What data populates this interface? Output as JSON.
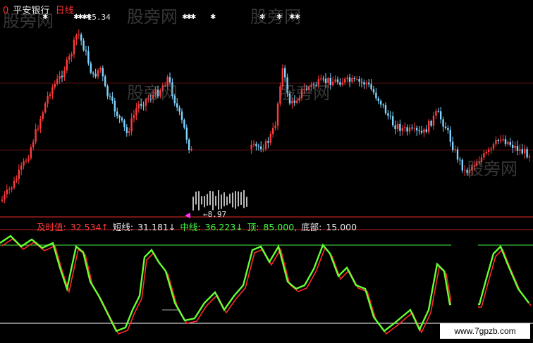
{
  "header": {
    "marker": "0",
    "stock_name": "平安银行",
    "period": "日线"
  },
  "price_pane": {
    "high_label": "←15.34",
    "low_label": "←8.97"
  },
  "indicator": {
    "name_label": "及时值:",
    "name_value": "32.534↑",
    "short_label": "短线:",
    "short_value": "31.181↓",
    "mid_label": "中线:",
    "mid_value": "36.223↓",
    "top_label": "顶:",
    "top_value": "85.000,",
    "bottom_label": "底部:",
    "bottom_value": "15.000"
  },
  "watermarks": [
    "股旁网",
    "股旁网",
    "股旁网",
    "股旁网",
    "股旁网",
    "股旁网"
  ],
  "site": "www.7gpzb.com",
  "colors": {
    "up": "#ff3a3a",
    "down": "#7fd4ff",
    "fast_line": "#ff2a2a",
    "slow_line": "#66ff33",
    "top_line": "#3bbf3b",
    "bottom_line": "#cfcfcf"
  }
}
